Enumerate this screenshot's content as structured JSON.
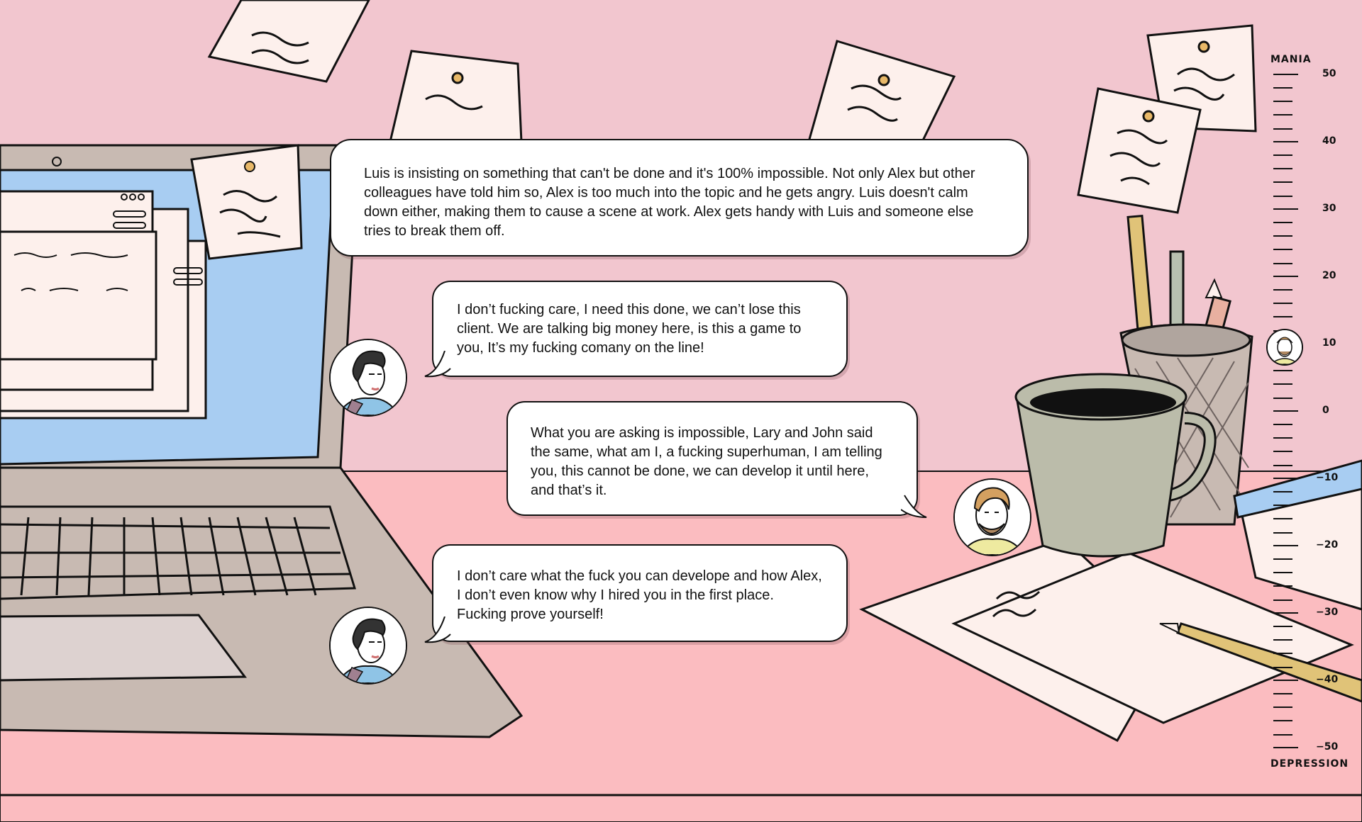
{
  "bubbles": [
    {
      "id": "narration",
      "text": "Luis is insisting on something that can't be done and it's 100% impossible. Not only Alex but other colleagues have told him so, Alex is too much into the topic and he gets angry. Luis doesn't calm down either, making them to cause a scene at work. Alex gets handy with Luis and someone else tries to break them off."
    },
    {
      "id": "luis-1",
      "speaker": "Luis",
      "text": "I don’t fucking care, I need this done, we can’t lose this client. We are talking big money here, is this a game to you, It’s my fucking comany on the line!"
    },
    {
      "id": "alex-1",
      "speaker": "Alex",
      "text": "What you are asking is impossible, Lary and John said the same, what am I, a fucking superhuman, I am telling you, this cannot be done, we can develop it until here, and that’s it."
    },
    {
      "id": "luis-2",
      "speaker": "Luis",
      "text": "I don’t care what the fuck you can develope and how Alex, I don’t even know why I hired you in the first place. Fucking prove yourself!"
    }
  ],
  "mood_scale": {
    "top_label": "MANIA",
    "bottom_label": "DEPRESSION",
    "ticks": [
      "50",
      "40",
      "30",
      "20",
      "10",
      "0",
      "−10",
      "−20",
      "−30",
      "−40",
      "−50"
    ],
    "current_value": 10,
    "current_person": "Alex"
  },
  "colors": {
    "wall": "#f2c6cf",
    "desk": "#fbbcc0",
    "laptop_body": "#c8bab2",
    "screen": "#a8cdf2",
    "paper": "#fdf0ec",
    "mug": "#bbbcaa"
  },
  "icons": [
    "luis-avatar",
    "alex-avatar",
    "laptop-icon",
    "coffee-mug-icon",
    "pencil-cup-icon",
    "book-icon",
    "sticky-note-icon"
  ]
}
